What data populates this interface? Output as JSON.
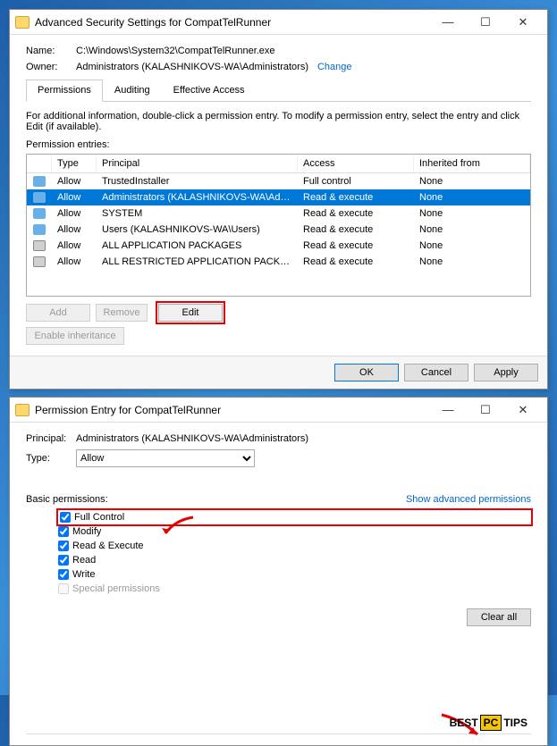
{
  "win1": {
    "title": "Advanced Security Settings for CompatTelRunner",
    "name_lbl": "Name:",
    "name_val": "C:\\Windows\\System32\\CompatTelRunner.exe",
    "owner_lbl": "Owner:",
    "owner_val": "Administrators (KALASHNIKOVS-WA\\Administrators)",
    "change": "Change",
    "tabs": {
      "perm": "Permissions",
      "aud": "Auditing",
      "eff": "Effective Access"
    },
    "info": "For additional information, double-click a permission entry. To modify a permission entry, select the entry and click Edit (if available).",
    "entries_lbl": "Permission entries:",
    "cols": {
      "type": "Type",
      "prin": "Principal",
      "acc": "Access",
      "inh": "Inherited from"
    },
    "rows": [
      {
        "type": "Allow",
        "prin": "TrustedInstaller",
        "acc": "Full control",
        "inh": "None",
        "icon": "user",
        "sel": false
      },
      {
        "type": "Allow",
        "prin": "Administrators (KALASHNIKOVS-WA\\Admi...",
        "acc": "Read & execute",
        "inh": "None",
        "icon": "user",
        "sel": true
      },
      {
        "type": "Allow",
        "prin": "SYSTEM",
        "acc": "Read & execute",
        "inh": "None",
        "icon": "user",
        "sel": false
      },
      {
        "type": "Allow",
        "prin": "Users (KALASHNIKOVS-WA\\Users)",
        "acc": "Read & execute",
        "inh": "None",
        "icon": "user",
        "sel": false
      },
      {
        "type": "Allow",
        "prin": "ALL APPLICATION PACKAGES",
        "acc": "Read & execute",
        "inh": "None",
        "icon": "pkg",
        "sel": false
      },
      {
        "type": "Allow",
        "prin": "ALL RESTRICTED APPLICATION PACKAGES",
        "acc": "Read & execute",
        "inh": "None",
        "icon": "pkg",
        "sel": false
      }
    ],
    "btns": {
      "add": "Add",
      "remove": "Remove",
      "edit": "Edit",
      "enable": "Enable inheritance",
      "ok": "OK",
      "cancel": "Cancel",
      "apply": "Apply"
    }
  },
  "win2": {
    "title": "Permission Entry for CompatTelRunner",
    "prin_lbl": "Principal:",
    "prin_val": "Administrators (KALASHNIKOVS-WA\\Administrators)",
    "type_lbl": "Type:",
    "type_val": "Allow",
    "basic_lbl": "Basic permissions:",
    "adv_link": "Show advanced permissions",
    "perms": [
      {
        "label": "Full Control",
        "checked": true,
        "hl": true
      },
      {
        "label": "Modify",
        "checked": true,
        "hl": false
      },
      {
        "label": "Read & Execute",
        "checked": true,
        "hl": false
      },
      {
        "label": "Read",
        "checked": true,
        "hl": false
      },
      {
        "label": "Write",
        "checked": true,
        "hl": false
      },
      {
        "label": "Special permissions",
        "checked": false,
        "hl": false,
        "dis": true
      }
    ],
    "clear": "Clear all"
  },
  "watermark": {
    "a": "BEST",
    "b": "PC",
    "c": "TIPS"
  }
}
